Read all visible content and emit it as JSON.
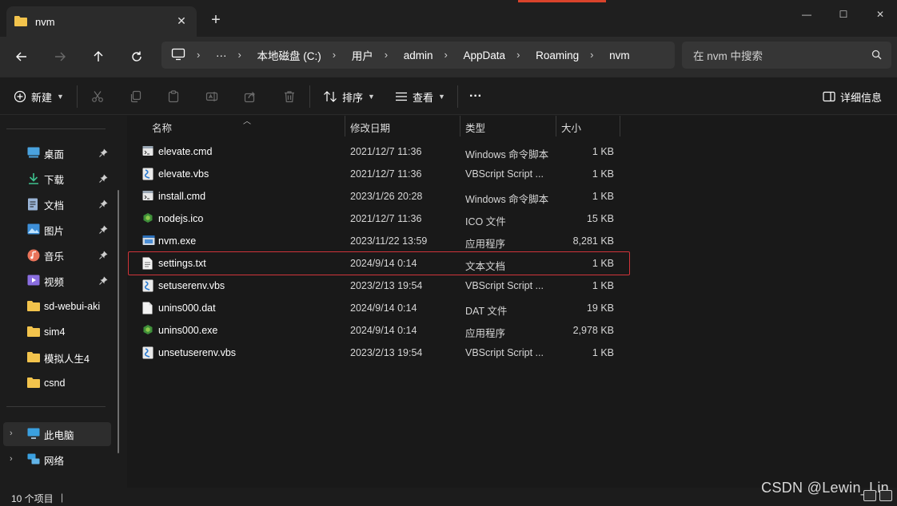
{
  "tab": {
    "title": "nvm",
    "close": "✕",
    "new_tab": "+"
  },
  "window": {
    "minimize": "—",
    "maximize": "☐",
    "close": "✕"
  },
  "address": {
    "crumbs": [
      "本地磁盘 (C:)",
      "用户",
      "admin",
      "AppData",
      "Roaming",
      "nvm"
    ],
    "more": "···"
  },
  "search": {
    "placeholder": "在 nvm 中搜索"
  },
  "commandbar": {
    "new_label": "新建",
    "sort_label": "排序",
    "view_label": "查看",
    "more": "···",
    "details_label": "详细信息"
  },
  "sidebar": {
    "quick": [
      {
        "label": "桌面",
        "icon": "desktop-icon",
        "color": "#4aa3df"
      },
      {
        "label": "下载",
        "icon": "download-icon",
        "color": "#3ec28f"
      },
      {
        "label": "文档",
        "icon": "documents-icon",
        "color": "#9ab4d6"
      },
      {
        "label": "图片",
        "icon": "pictures-icon",
        "color": "#3d8fd8"
      },
      {
        "label": "音乐",
        "icon": "music-icon",
        "color": "#e9735a"
      },
      {
        "label": "视频",
        "icon": "videos-icon",
        "color": "#8a6ee0"
      },
      {
        "label": "sd-webui-aki",
        "icon": "folder-icon",
        "color": "#f2c34c"
      },
      {
        "label": "sim4",
        "icon": "folder-icon",
        "color": "#f2c34c"
      },
      {
        "label": "模拟人生4",
        "icon": "folder-icon",
        "color": "#f2c34c"
      },
      {
        "label": "csnd",
        "icon": "folder-icon",
        "color": "#f2c34c"
      }
    ],
    "this_pc": "此电脑",
    "network": "网络"
  },
  "columns": {
    "name": "名称",
    "modified": "修改日期",
    "type": "类型",
    "size": "大小"
  },
  "files": [
    {
      "name": "elevate.cmd",
      "modified": "2021/12/7 11:36",
      "type": "Windows 命令脚本",
      "size": "1 KB",
      "icon": "cmd-file-icon"
    },
    {
      "name": "elevate.vbs",
      "modified": "2021/12/7 11:36",
      "type": "VBScript Script ...",
      "size": "1 KB",
      "icon": "vbs-file-icon"
    },
    {
      "name": "install.cmd",
      "modified": "2023/1/26 20:28",
      "type": "Windows 命令脚本",
      "size": "1 KB",
      "icon": "cmd-file-icon"
    },
    {
      "name": "nodejs.ico",
      "modified": "2021/12/7 11:36",
      "type": "ICO 文件",
      "size": "15 KB",
      "icon": "nodejs-icon"
    },
    {
      "name": "nvm.exe",
      "modified": "2023/11/22 13:59",
      "type": "应用程序",
      "size": "8,281 KB",
      "icon": "exe-file-icon"
    },
    {
      "name": "settings.txt",
      "modified": "2024/9/14 0:14",
      "type": "文本文档",
      "size": "1 KB",
      "icon": "txt-file-icon"
    },
    {
      "name": "setuserenv.vbs",
      "modified": "2023/2/13 19:54",
      "type": "VBScript Script ...",
      "size": "1 KB",
      "icon": "vbs-file-icon"
    },
    {
      "name": "unins000.dat",
      "modified": "2024/9/14 0:14",
      "type": "DAT 文件",
      "size": "19 KB",
      "icon": "dat-file-icon"
    },
    {
      "name": "unins000.exe",
      "modified": "2024/9/14 0:14",
      "type": "应用程序",
      "size": "2,978 KB",
      "icon": "nodejs-icon"
    },
    {
      "name": "unsetuserenv.vbs",
      "modified": "2023/2/13 19:54",
      "type": "VBScript Script ...",
      "size": "1 KB",
      "icon": "vbs-file-icon"
    }
  ],
  "status": {
    "count": "10 个项目",
    "divider": "|"
  },
  "watermark": "CSDN @Lewin_Lin",
  "colors": {
    "highlight": "#d1343a",
    "folder": "#f2c34c",
    "accent": "#d9432b"
  }
}
